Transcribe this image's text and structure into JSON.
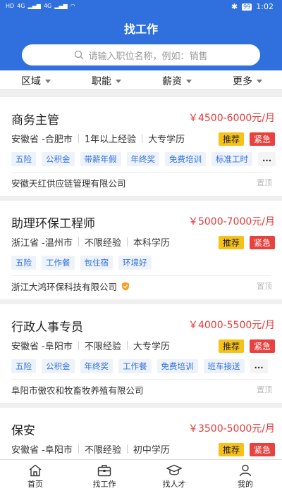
{
  "status_bar": {
    "left": [
      "HD",
      "4G",
      "4G"
    ],
    "battery": "99",
    "time": "1:02"
  },
  "header": {
    "title": "找工作",
    "search_placeholder": "请输入职位名称，例如：销售"
  },
  "filters": [
    "区域",
    "职能",
    "薪资",
    "更多"
  ],
  "jobs": [
    {
      "title": "商务主管",
      "salary": "￥4500-6000元/月",
      "location": "安徽省 -合肥市",
      "experience": "1年以上经验",
      "education": "大专学历",
      "badge_recommend": "推荐",
      "badge_urgent": "紧急",
      "tags": [
        "五险",
        "公积金",
        "带薪年假",
        "年终奖",
        "免费培训",
        "标准工时"
      ],
      "more": "...",
      "company": "安徽天红供应链管理有限公司",
      "pin": "置顶"
    },
    {
      "title": "助理环保工程师",
      "salary": "￥5000-7000元/月",
      "location": "浙江省 -温州市",
      "experience": "不限经验",
      "education": "本科学历",
      "badge_recommend": "推荐",
      "badge_urgent": "紧急",
      "tags": [
        "五险",
        "工作餐",
        "包住宿",
        "环境好"
      ],
      "more": "",
      "company": "浙江大鸿环保科技有限公司",
      "pin": "置顶"
    },
    {
      "title": "行政人事专员",
      "salary": "￥4000-5500元/月",
      "location": "安徽省 -阜阳市",
      "experience": "不限经验",
      "education": "大专学历",
      "badge_recommend": "推荐",
      "badge_urgent": "紧急",
      "tags": [
        "五险",
        "公积金",
        "年终奖",
        "工作餐",
        "免费培训",
        "班车接送"
      ],
      "more": "...",
      "company": "阜阳市傲农和牧畜牧养殖有限公司",
      "pin": "置顶"
    },
    {
      "title": "保安",
      "salary": "￥3500-5000元/月",
      "location": "安徽省 -阜阳市",
      "experience": "不限经验",
      "education": "初中学历",
      "badge_recommend": "推荐",
      "badge_urgent": "紧急",
      "tags": [],
      "more": "",
      "company": "",
      "pin": ""
    }
  ],
  "tabbar": [
    "首页",
    "找工作",
    "找人才",
    "我的"
  ],
  "colors": {
    "brand": "#2f6fde",
    "salary": "#e23b3b",
    "recommend": "#f6c21a",
    "urgent": "#e8423f"
  }
}
